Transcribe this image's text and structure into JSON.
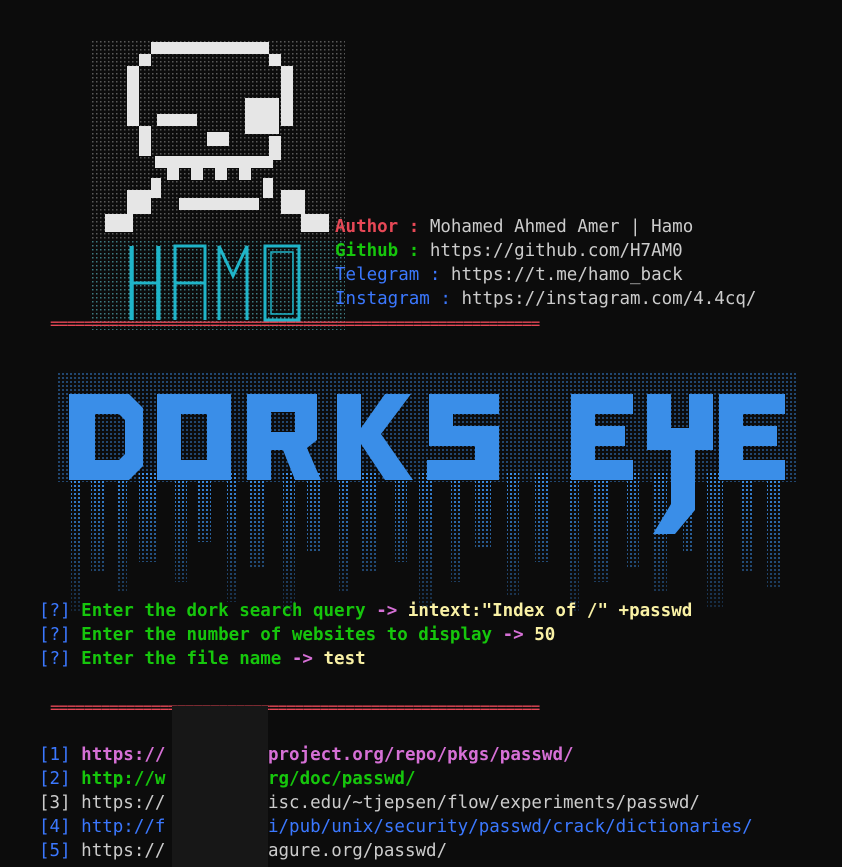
{
  "logo": {
    "text": "HAMO",
    "skull_color": "#e6e6e6",
    "text_color": "#1fb5c9",
    "dot_color": "#a8a8a8"
  },
  "author_info": [
    {
      "label": "Author : ",
      "value": "Mohamed Ahmed Amer | Hamo",
      "label_color": "red"
    },
    {
      "label": "Github : ",
      "value": "https://github.com/H7AM0",
      "label_color": "green"
    },
    {
      "label": "Telegram : ",
      "value": "https://t.me/hamo_back",
      "label_color": "blue"
    },
    {
      "label": "Instagram : ",
      "value": "https://instagram.com/4.4cq/",
      "label_color": "blue"
    }
  ],
  "separator": "==========================================================",
  "banner": {
    "text": "DORKS EYE",
    "color": "#3a8ee8"
  },
  "prompts": [
    {
      "marker": "[?]",
      "text": "Enter the dork search query",
      "arrow": "->",
      "answer": "intext:\"Index of /\" +passwd"
    },
    {
      "marker": "[?]",
      "text": "Enter the number of websites to display",
      "arrow": "->",
      "answer": "50"
    },
    {
      "marker": "[?]",
      "text": "Enter the file name",
      "arrow": "->",
      "answer": "test"
    }
  ],
  "results": [
    {
      "index": "[1]",
      "url_start": "https://",
      "url_end": "aproject.org/repo/pkgs/passwd/",
      "color": "magenta"
    },
    {
      "index": "[2]",
      "url_start": "http://w",
      "url_end": "org/doc/passwd/",
      "color": "green"
    },
    {
      "index": "[3]",
      "url_start": "https://",
      "url_end": "wisc.edu/~tjepsen/flow/experiments/passwd/",
      "color": "white"
    },
    {
      "index": "[4]",
      "url_start": "http://f",
      "url_end": "fi/pub/unix/security/passwd/crack/dictionaries/",
      "color": "blue"
    },
    {
      "index": "[5]",
      "url_start": "https://",
      "url_end": "pagure.org/passwd/",
      "color": "white"
    }
  ]
}
